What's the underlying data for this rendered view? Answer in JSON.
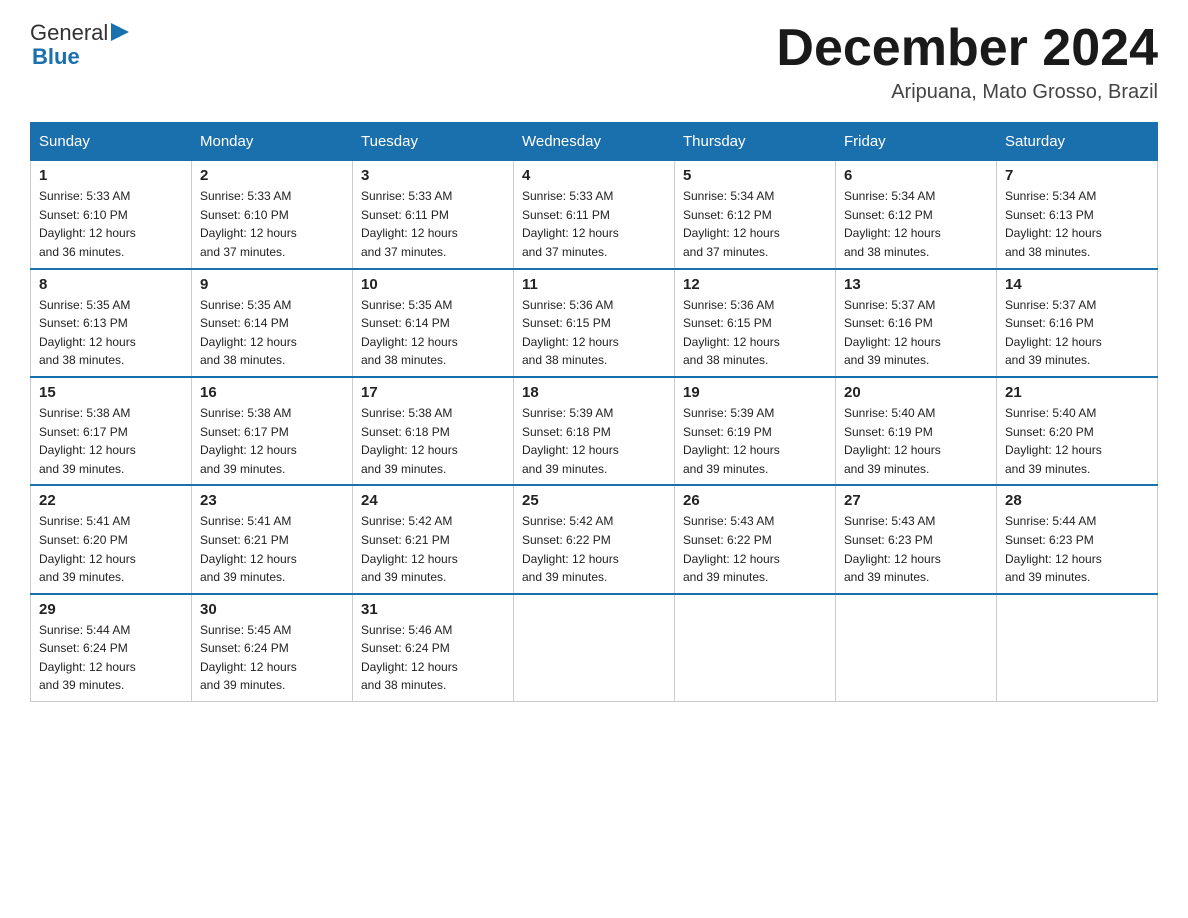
{
  "header": {
    "logo_general": "General",
    "logo_blue": "Blue",
    "month_title": "December 2024",
    "location": "Aripuana, Mato Grosso, Brazil"
  },
  "weekdays": [
    "Sunday",
    "Monday",
    "Tuesday",
    "Wednesday",
    "Thursday",
    "Friday",
    "Saturday"
  ],
  "weeks": [
    [
      {
        "day": "1",
        "sunrise": "5:33 AM",
        "sunset": "6:10 PM",
        "daylight": "12 hours and 36 minutes."
      },
      {
        "day": "2",
        "sunrise": "5:33 AM",
        "sunset": "6:10 PM",
        "daylight": "12 hours and 37 minutes."
      },
      {
        "day": "3",
        "sunrise": "5:33 AM",
        "sunset": "6:11 PM",
        "daylight": "12 hours and 37 minutes."
      },
      {
        "day": "4",
        "sunrise": "5:33 AM",
        "sunset": "6:11 PM",
        "daylight": "12 hours and 37 minutes."
      },
      {
        "day": "5",
        "sunrise": "5:34 AM",
        "sunset": "6:12 PM",
        "daylight": "12 hours and 37 minutes."
      },
      {
        "day": "6",
        "sunrise": "5:34 AM",
        "sunset": "6:12 PM",
        "daylight": "12 hours and 38 minutes."
      },
      {
        "day": "7",
        "sunrise": "5:34 AM",
        "sunset": "6:13 PM",
        "daylight": "12 hours and 38 minutes."
      }
    ],
    [
      {
        "day": "8",
        "sunrise": "5:35 AM",
        "sunset": "6:13 PM",
        "daylight": "12 hours and 38 minutes."
      },
      {
        "day": "9",
        "sunrise": "5:35 AM",
        "sunset": "6:14 PM",
        "daylight": "12 hours and 38 minutes."
      },
      {
        "day": "10",
        "sunrise": "5:35 AM",
        "sunset": "6:14 PM",
        "daylight": "12 hours and 38 minutes."
      },
      {
        "day": "11",
        "sunrise": "5:36 AM",
        "sunset": "6:15 PM",
        "daylight": "12 hours and 38 minutes."
      },
      {
        "day": "12",
        "sunrise": "5:36 AM",
        "sunset": "6:15 PM",
        "daylight": "12 hours and 38 minutes."
      },
      {
        "day": "13",
        "sunrise": "5:37 AM",
        "sunset": "6:16 PM",
        "daylight": "12 hours and 39 minutes."
      },
      {
        "day": "14",
        "sunrise": "5:37 AM",
        "sunset": "6:16 PM",
        "daylight": "12 hours and 39 minutes."
      }
    ],
    [
      {
        "day": "15",
        "sunrise": "5:38 AM",
        "sunset": "6:17 PM",
        "daylight": "12 hours and 39 minutes."
      },
      {
        "day": "16",
        "sunrise": "5:38 AM",
        "sunset": "6:17 PM",
        "daylight": "12 hours and 39 minutes."
      },
      {
        "day": "17",
        "sunrise": "5:38 AM",
        "sunset": "6:18 PM",
        "daylight": "12 hours and 39 minutes."
      },
      {
        "day": "18",
        "sunrise": "5:39 AM",
        "sunset": "6:18 PM",
        "daylight": "12 hours and 39 minutes."
      },
      {
        "day": "19",
        "sunrise": "5:39 AM",
        "sunset": "6:19 PM",
        "daylight": "12 hours and 39 minutes."
      },
      {
        "day": "20",
        "sunrise": "5:40 AM",
        "sunset": "6:19 PM",
        "daylight": "12 hours and 39 minutes."
      },
      {
        "day": "21",
        "sunrise": "5:40 AM",
        "sunset": "6:20 PM",
        "daylight": "12 hours and 39 minutes."
      }
    ],
    [
      {
        "day": "22",
        "sunrise": "5:41 AM",
        "sunset": "6:20 PM",
        "daylight": "12 hours and 39 minutes."
      },
      {
        "day": "23",
        "sunrise": "5:41 AM",
        "sunset": "6:21 PM",
        "daylight": "12 hours and 39 minutes."
      },
      {
        "day": "24",
        "sunrise": "5:42 AM",
        "sunset": "6:21 PM",
        "daylight": "12 hours and 39 minutes."
      },
      {
        "day": "25",
        "sunrise": "5:42 AM",
        "sunset": "6:22 PM",
        "daylight": "12 hours and 39 minutes."
      },
      {
        "day": "26",
        "sunrise": "5:43 AM",
        "sunset": "6:22 PM",
        "daylight": "12 hours and 39 minutes."
      },
      {
        "day": "27",
        "sunrise": "5:43 AM",
        "sunset": "6:23 PM",
        "daylight": "12 hours and 39 minutes."
      },
      {
        "day": "28",
        "sunrise": "5:44 AM",
        "sunset": "6:23 PM",
        "daylight": "12 hours and 39 minutes."
      }
    ],
    [
      {
        "day": "29",
        "sunrise": "5:44 AM",
        "sunset": "6:24 PM",
        "daylight": "12 hours and 39 minutes."
      },
      {
        "day": "30",
        "sunrise": "5:45 AM",
        "sunset": "6:24 PM",
        "daylight": "12 hours and 39 minutes."
      },
      {
        "day": "31",
        "sunrise": "5:46 AM",
        "sunset": "6:24 PM",
        "daylight": "12 hours and 38 minutes."
      },
      null,
      null,
      null,
      null
    ]
  ],
  "labels": {
    "sunrise": "Sunrise:",
    "sunset": "Sunset:",
    "daylight": "Daylight:"
  }
}
